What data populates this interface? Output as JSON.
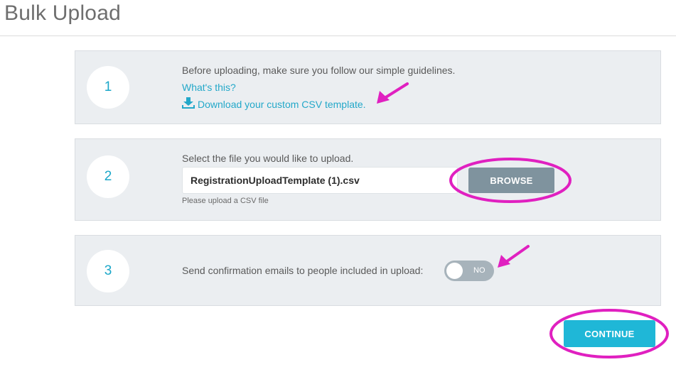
{
  "header": {
    "title": "Bulk Upload"
  },
  "steps": [
    {
      "number": "1",
      "text": "Before uploading, make sure you follow our simple guidelines.",
      "link_whats_this": "What's this?",
      "link_download": "Download your custom CSV template."
    },
    {
      "number": "2",
      "text": "Select the file you would like to upload.",
      "file_value": "RegistrationUploadTemplate (1).csv",
      "browse_label": "BROWSE",
      "help": "Please upload a CSV file"
    },
    {
      "number": "3",
      "text": "Send confirmation emails to people included in upload:",
      "toggle_label": "NO"
    }
  ],
  "footer": {
    "continue_label": "CONTINUE"
  },
  "icons": {
    "download": "download-icon"
  },
  "colors": {
    "accent": "#1fb7d7",
    "link": "#23a8c9",
    "panel_bg": "#ebeef1",
    "browse_bg": "#7f939e",
    "toggle_off_bg": "#a7b3bb",
    "annotation": "#e020c0"
  }
}
